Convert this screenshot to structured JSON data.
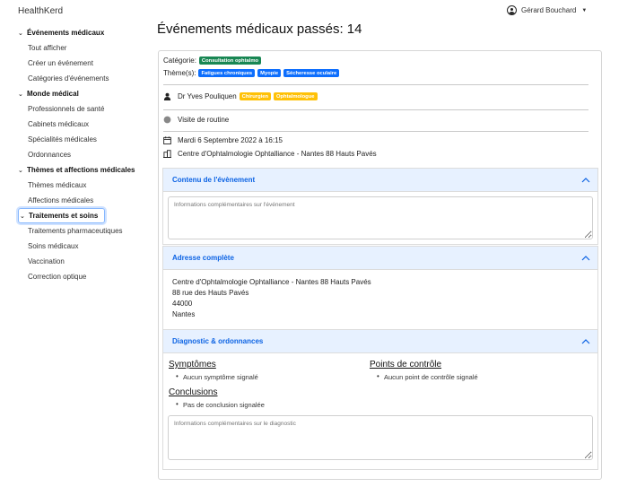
{
  "app": {
    "brand": "HealthKerd",
    "user_name": "Gérard Bouchard"
  },
  "sidebar": {
    "sections": [
      {
        "label": "Événements médicaux",
        "items": [
          "Tout afficher",
          "Créer un événement",
          "Catégories d'événements"
        ]
      },
      {
        "label": "Monde médical",
        "items": [
          "Professionnels de santé",
          "Cabinets médicaux",
          "Spécialités médicales",
          "Ordonnances"
        ]
      },
      {
        "label": "Thèmes et affections médicales",
        "items": [
          "Thèmes médicaux",
          "Affections médicales"
        ]
      },
      {
        "label": "Traitements et soins",
        "items": [
          "Traitements pharmaceutiques",
          "Soins médicaux",
          "Vaccination",
          "Correction optique"
        ]
      }
    ]
  },
  "main": {
    "title": "Événements médicaux passés: 14",
    "category_label": "Catégorie:",
    "category_badge": "Consultation ophtalmo",
    "themes_label": "Thème(s):",
    "themes": [
      "Fatigues chroniques",
      "Myopie",
      "Sécheresse oculaire"
    ],
    "doctor_name": "Dr Yves Pouliquen",
    "doctor_specialties": [
      "Chirurgien",
      "Ophtalmologue"
    ],
    "visit_type": "Visite de routine",
    "date": "Mardi 6 Septembre 2022 à 16:15",
    "place": "Centre d'Ophtalmologie Ophtalliance - Nantes 88 Hauts Pavés",
    "content_section": {
      "title": "Contenu de l'évènement",
      "placeholder": "Informations complémentaires sur l'événement"
    },
    "address_section": {
      "title": "Adresse complète",
      "lines": [
        "Centre d'Ophtalmologie Ophtalliance - Nantes 88 Hauts Pavés",
        "88 rue des Hauts Pavés",
        "44000",
        "Nantes"
      ]
    },
    "diagnostic_section": {
      "title": "Diagnostic & ordonnances",
      "symptoms_title": "Symptômes",
      "symptoms_empty": "Aucun symptôme signalé",
      "checkpoints_title": "Points de contrôle",
      "checkpoints_empty": "Aucun point de contrôle signalé",
      "conclusions_title": "Conclusions",
      "conclusions_empty": "Pas de conclusion signalée",
      "placeholder": "Informations complémentaires sur le diagnostic"
    }
  },
  "colors": {
    "badge_green": "#198754",
    "badge_blue": "#0d6efd",
    "badge_yellow": "#ffc107",
    "accordion_header_bg": "#e7f1ff",
    "accordion_header_text": "#0c63e4"
  }
}
